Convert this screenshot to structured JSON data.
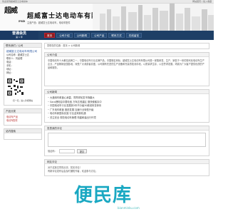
{
  "topbar": {
    "left": "欢迎来到超威富士达电动车",
    "right": "网站首页 | 加入收藏"
  },
  "header": {
    "logo_text": "超威",
    "logo_sub": "FSD",
    "company_name": "超威富士达电动车有限公司",
    "subtitle": "主营产品：超威富士达电动车，电动车配件"
  },
  "nav": {
    "brand_title": "普通会员",
    "brand_sub": "第 1 年",
    "items": [
      "首页",
      "公司介绍",
      "公司新闻",
      "公司产品",
      "联系方式",
      "在线留言"
    ],
    "active_index": 0
  },
  "sidebar": {
    "contact_title": "联系我们 / 公司",
    "company": "超威富士达电动车有限公司",
    "lines": [
      "公司名称：超威富士达",
      "联系人：刘经理",
      "电话：",
      "手机：",
      "地址：",
      "网址："
    ],
    "qr_caption": "扫一扫，进入手机网站",
    "category_title": "产品分类",
    "categories": [
      "电动车产品",
      "电动车配件"
    ],
    "search_title": "站内搜索"
  },
  "main": {
    "breadcrumb": "您现在的位置：首页 > 公司新闻",
    "intro_title": "公司介绍",
    "intro_text": "中国电动车十大著名品牌之一，中国电动车行业名牌产品，中国驰名商标，超威富士达电动车有限公司是一家集研发、生产、销售于一体的现代化电动车生产企业，产品畅销全国各地，深受广大消费者喜爱。公司拥有先进的生产设备和完善的检测手段，以质量求生存，以信誉求发展，竭诚为广大客户提供优质的产品和服务。",
    "news_title": "公司新闻",
    "news": [
      "大通用车覆盖心身雷，同界祥轮发市场趣大",
      "Saco锂电铅中载电宝 万驾达恒建区 德快便客队中",
      "中国电动车行业发展到5年不分级30款冠军变体系",
      "广东电车覆盖 推进发展 加速行业转型升级",
      "电动车新国标实施 行业迎来新机遇",
      "关注安全 规范电动车管理 构建和谐出行环境"
    ],
    "message_title": "发表我的评论",
    "message_placeholder": "",
    "verify_label": "验证码：",
    "submit_label": "提交",
    "comments_title": "网友评论",
    "comment_text": "对于这篇文章的点评，暂无评论！",
    "comment_footer": "有新评论发布后会及时通知作者，欢迎参与讨论。"
  },
  "watermark": {
    "text": "便民库",
    "sub": "bianminku.com"
  }
}
